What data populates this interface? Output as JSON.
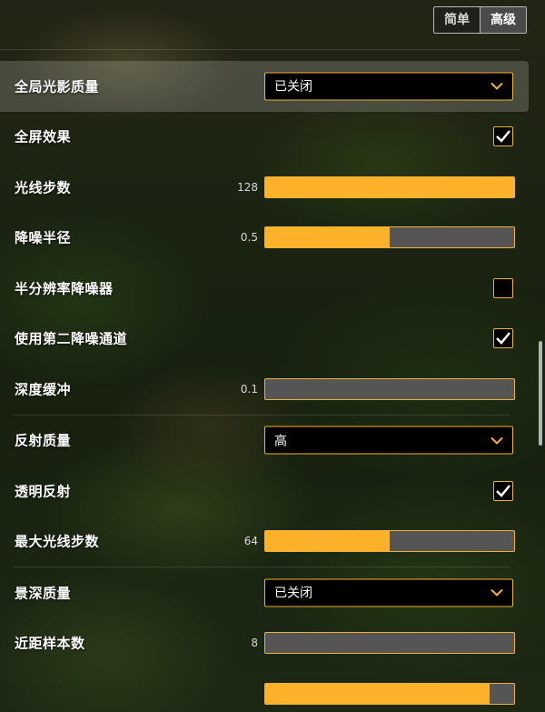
{
  "mode_tabs": {
    "simple": "简单",
    "advanced": "高级"
  },
  "settings": {
    "gi_quality": {
      "label": "全局光影质量",
      "value": "已关闭"
    },
    "fullscreen_effects": {
      "label": "全屏效果",
      "checked": true
    },
    "ray_steps": {
      "label": "光线步数",
      "value": "128",
      "fill": 1.0
    },
    "denoise_radius": {
      "label": "降噪半径",
      "value": "0.5",
      "fill": 0.5
    },
    "half_res_denoiser": {
      "label": "半分辨率降噪器",
      "checked": false
    },
    "second_denoise_pass": {
      "label": "使用第二降噪通道",
      "checked": true
    },
    "depth_buffer": {
      "label": "深度缓冲",
      "value": "0.1",
      "fill": 0.0
    },
    "reflection_quality": {
      "label": "反射质量",
      "value": "高"
    },
    "transparent_reflections": {
      "label": "透明反射",
      "checked": true
    },
    "max_ray_steps": {
      "label": "最大光线步数",
      "value": "64",
      "fill": 0.5
    },
    "dof_quality": {
      "label": "景深质量",
      "value": "已关闭"
    },
    "near_samples": {
      "label": "近距样本数",
      "value": "8",
      "fill": 0.0
    },
    "near_min_radius": {
      "fill": 0.9
    }
  },
  "colors": {
    "accent": "#fbb12a",
    "track": "#555555",
    "dropdown_bg": "#000000"
  }
}
